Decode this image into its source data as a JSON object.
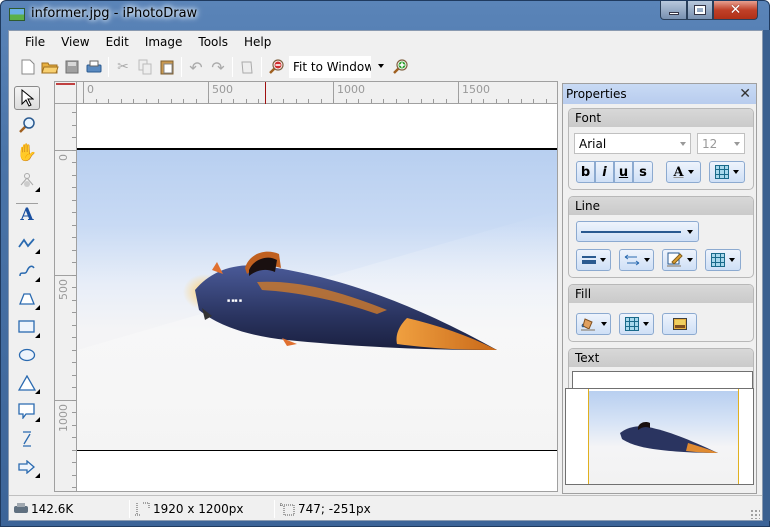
{
  "window": {
    "title": "informer.jpg - iPhotoDraw",
    "controls": {
      "minimize": "minimize",
      "maximize": "maximize",
      "close": "close"
    }
  },
  "menu": [
    "File",
    "View",
    "Edit",
    "Image",
    "Tools",
    "Help"
  ],
  "toolbar": {
    "buttons": [
      "new-file",
      "open-folder",
      "save",
      "print",
      "cut",
      "copy",
      "paste",
      "undo",
      "redo",
      "crop",
      "zoom-out",
      "zoom-in"
    ],
    "zoom_value": "Fit to Window"
  },
  "tools": [
    "select",
    "zoom",
    "pan",
    "node-edit",
    "text",
    "polyline",
    "curve",
    "freeform",
    "rectangle",
    "ellipse",
    "triangle",
    "callout",
    "dimension",
    "arrow-shape"
  ],
  "ruler": {
    "horizontal_labels": [
      "0",
      "500",
      "1000",
      "1500"
    ],
    "vertical_labels": [
      "0",
      "500",
      "1000"
    ]
  },
  "properties": {
    "title": "Properties",
    "font": {
      "label": "Font",
      "family": "Arial",
      "size": "12",
      "style_buttons": [
        "b",
        "i",
        "u",
        "s"
      ],
      "color_button_glyph": "A"
    },
    "line": {
      "label": "Line"
    },
    "fill": {
      "label": "Fill"
    },
    "text": {
      "label": "Text",
      "value": ""
    }
  },
  "status": {
    "file_size": "142.6K",
    "dimensions": "1920 x 1200px",
    "cursor": "747; -251px"
  },
  "colors": {
    "titlebar": "#4a74a8",
    "props_header": "#c8daf4",
    "button_border": "#8caad0",
    "ruler_marker": "#a01010"
  }
}
